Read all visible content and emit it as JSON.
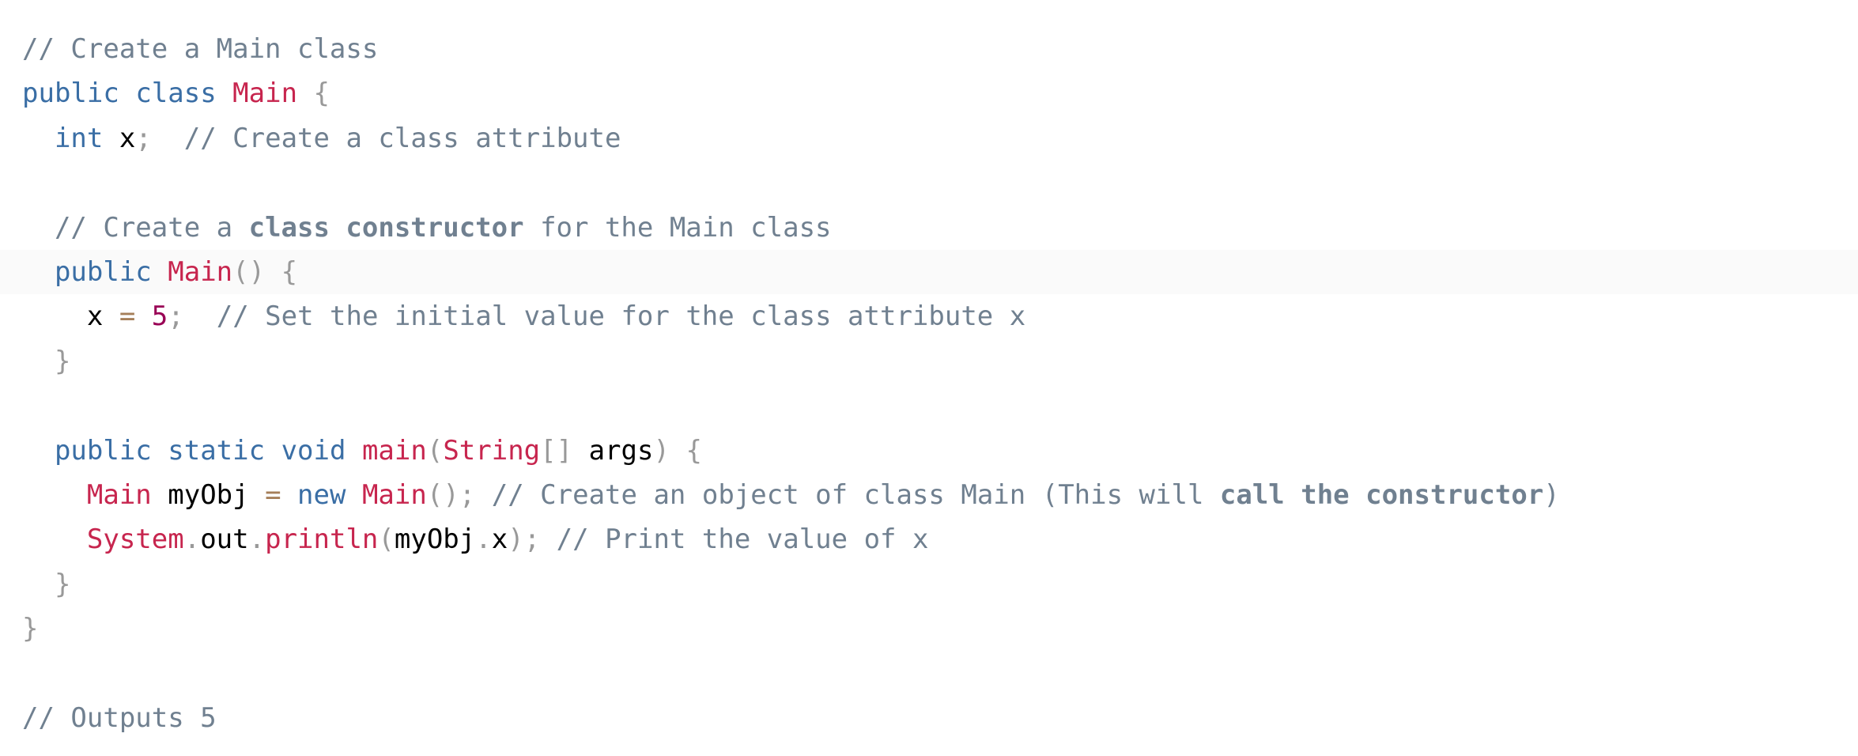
{
  "editor": {
    "colors": {
      "keyword": "#3a6ea5",
      "type": "#c7254e",
      "punctuation": "#999999",
      "comment": "#708090",
      "operator": "#a67f59",
      "number": "#990055",
      "plain": "#000000",
      "highlight": "#fafafa"
    },
    "lines": [
      [
        {
          "t": "// Create a Main class",
          "c": "comment"
        }
      ],
      [
        {
          "t": "public",
          "c": "keyword"
        },
        {
          "t": " ",
          "c": "plain"
        },
        {
          "t": "class",
          "c": "keyword"
        },
        {
          "t": " ",
          "c": "plain"
        },
        {
          "t": "Main",
          "c": "type"
        },
        {
          "t": " ",
          "c": "plain"
        },
        {
          "t": "{",
          "c": "punct"
        }
      ],
      [
        {
          "t": "  ",
          "c": "plain"
        },
        {
          "t": "int",
          "c": "keyword"
        },
        {
          "t": " x",
          "c": "plain"
        },
        {
          "t": ";",
          "c": "punct"
        },
        {
          "t": "  ",
          "c": "plain"
        },
        {
          "t": "// Create a class attribute",
          "c": "comment"
        }
      ],
      [],
      [
        {
          "t": "  ",
          "c": "plain"
        },
        {
          "t": "// Create a ",
          "c": "comment"
        },
        {
          "t": "class constructor",
          "c": "comment-bold"
        },
        {
          "t": " for the Main class",
          "c": "comment"
        }
      ],
      [
        {
          "t": "  ",
          "c": "plain"
        },
        {
          "t": "public",
          "c": "keyword"
        },
        {
          "t": " ",
          "c": "plain"
        },
        {
          "t": "Main",
          "c": "method"
        },
        {
          "t": "()",
          "c": "punct"
        },
        {
          "t": " ",
          "c": "plain"
        },
        {
          "t": "{",
          "c": "punct"
        }
      ],
      [
        {
          "t": "    x ",
          "c": "plain"
        },
        {
          "t": "=",
          "c": "operator"
        },
        {
          "t": " ",
          "c": "plain"
        },
        {
          "t": "5",
          "c": "number"
        },
        {
          "t": ";",
          "c": "punct"
        },
        {
          "t": "  ",
          "c": "plain"
        },
        {
          "t": "// Set the initial value for the class attribute x",
          "c": "comment"
        }
      ],
      [
        {
          "t": "  ",
          "c": "plain"
        },
        {
          "t": "}",
          "c": "punct"
        }
      ],
      [],
      [
        {
          "t": "  ",
          "c": "plain"
        },
        {
          "t": "public",
          "c": "keyword"
        },
        {
          "t": " ",
          "c": "plain"
        },
        {
          "t": "static",
          "c": "keyword"
        },
        {
          "t": " ",
          "c": "plain"
        },
        {
          "t": "void",
          "c": "keyword"
        },
        {
          "t": " ",
          "c": "plain"
        },
        {
          "t": "main",
          "c": "method"
        },
        {
          "t": "(",
          "c": "punct"
        },
        {
          "t": "String",
          "c": "type"
        },
        {
          "t": "[]",
          "c": "punct"
        },
        {
          "t": " args",
          "c": "plain"
        },
        {
          "t": ")",
          "c": "punct"
        },
        {
          "t": " ",
          "c": "plain"
        },
        {
          "t": "{",
          "c": "punct"
        }
      ],
      [
        {
          "t": "    ",
          "c": "plain"
        },
        {
          "t": "Main",
          "c": "type"
        },
        {
          "t": " myObj ",
          "c": "plain"
        },
        {
          "t": "=",
          "c": "operator"
        },
        {
          "t": " ",
          "c": "plain"
        },
        {
          "t": "new",
          "c": "keyword"
        },
        {
          "t": " ",
          "c": "plain"
        },
        {
          "t": "Main",
          "c": "method"
        },
        {
          "t": "();",
          "c": "punct"
        },
        {
          "t": " ",
          "c": "plain"
        },
        {
          "t": "// Create an object of class Main (This will ",
          "c": "comment"
        },
        {
          "t": "call the constructor",
          "c": "comment-bold"
        },
        {
          "t": ")",
          "c": "comment"
        }
      ],
      [
        {
          "t": "    ",
          "c": "plain"
        },
        {
          "t": "System",
          "c": "type"
        },
        {
          "t": ".",
          "c": "punct"
        },
        {
          "t": "out",
          "c": "plain"
        },
        {
          "t": ".",
          "c": "punct"
        },
        {
          "t": "println",
          "c": "method"
        },
        {
          "t": "(",
          "c": "punct"
        },
        {
          "t": "myObj",
          "c": "plain"
        },
        {
          "t": ".",
          "c": "punct"
        },
        {
          "t": "x",
          "c": "plain"
        },
        {
          "t": ");",
          "c": "punct"
        },
        {
          "t": " ",
          "c": "plain"
        },
        {
          "t": "// Print the value of x",
          "c": "comment"
        }
      ],
      [
        {
          "t": "  ",
          "c": "plain"
        },
        {
          "t": "}",
          "c": "punct"
        }
      ],
      [
        {
          "t": "}",
          "c": "punct"
        }
      ],
      [],
      [
        {
          "t": "// Outputs 5",
          "c": "comment"
        }
      ]
    ],
    "highlighted_line_index": 5
  }
}
